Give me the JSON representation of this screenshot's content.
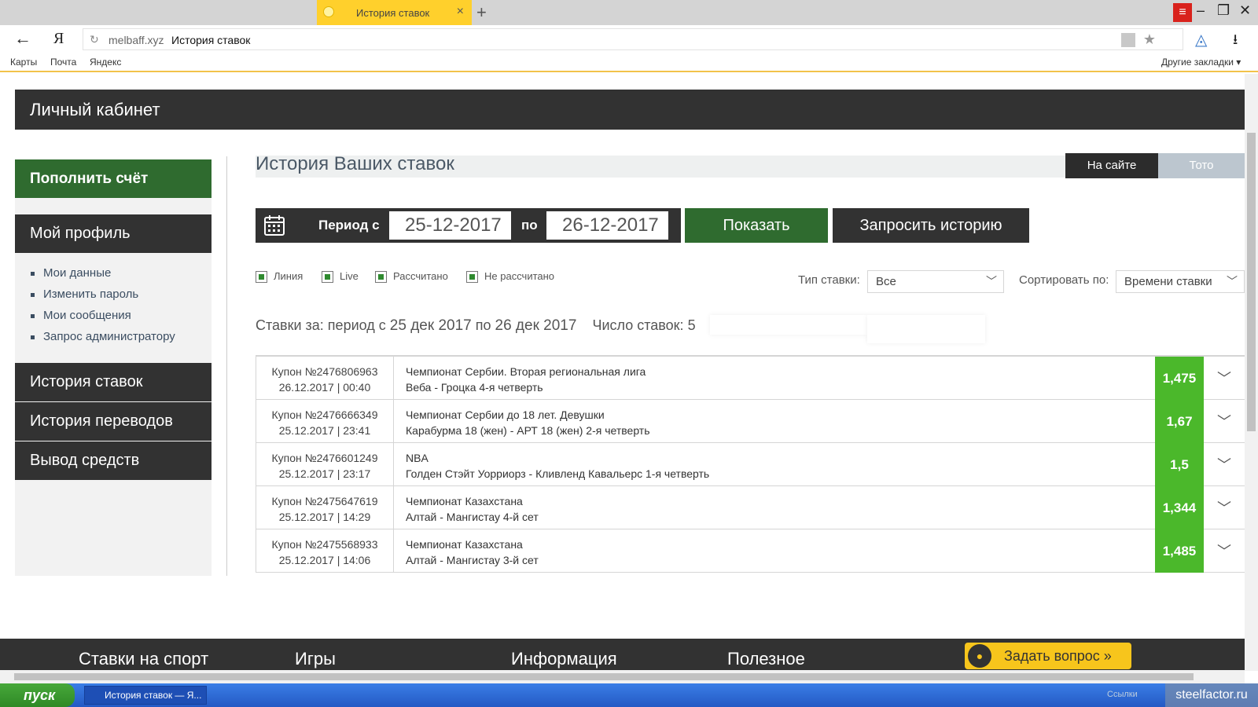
{
  "browser": {
    "tab_title": "История ставок",
    "tab_close": "×",
    "new_tab": "+",
    "url_host": "melbaff.xyz",
    "url_page": "История ставок",
    "bookmarks": [
      "Карты",
      "Почта",
      "Яндекс"
    ],
    "other_bookmarks": "Другие закладки ▾",
    "yandex_logo": "Я"
  },
  "header": {
    "title": "Личный кабинет"
  },
  "sidebar": {
    "deposit": "Пополнить счёт",
    "profile": "Мой профиль",
    "links": [
      "Мои данные",
      "Изменить пароль",
      "Мои сообщения",
      "Запрос администратору"
    ],
    "bet_history": "История ставок",
    "transfer_history": "История переводов",
    "withdraw": "Вывод средств"
  },
  "main": {
    "title": "История Ваших ставок",
    "tabs": [
      "На сайте",
      "Тото"
    ],
    "period_from_label": "Период с",
    "date_from": "25-12-2017",
    "period_to_label": "по",
    "date_to": "26-12-2017",
    "show_button": "Показать",
    "request_button": "Запросить историю",
    "filters": [
      "Линия",
      "Live",
      "Рассчитано",
      "Не рассчитано"
    ],
    "bet_type_label": "Тип ставки:",
    "bet_type_value": "Все",
    "sort_label": "Сортировать по:",
    "sort_value": "Времени ставки",
    "summary_prefix": "Ставки за: период с",
    "summary_from": "25 дек 2017",
    "summary_mid": "по",
    "summary_to": "26 дек 2017",
    "summary_count_label": "Число ставок:",
    "summary_count": "5"
  },
  "bets": [
    {
      "coupon": "Купон №2476806963",
      "datetime": "26.12.2017 | 00:40",
      "league": "Чемпионат Сербии. Вторая региональная лига",
      "match": "Веба - Гроцка 4-я четверть",
      "odds": "1,475"
    },
    {
      "coupon": "Купон №2476666349",
      "datetime": "25.12.2017 | 23:41",
      "league": "Чемпионат Сербии до 18 лет. Девушки",
      "match": "Карабурма 18 (жен) - АРТ 18 (жен) 2-я четверть",
      "odds": "1,67"
    },
    {
      "coupon": "Купон №2476601249",
      "datetime": "25.12.2017 | 23:17",
      "league": "NBA",
      "match": "Голден Стэйт Уорриорз - Кливленд Кавальерс 1-я четверть",
      "odds": "1,5"
    },
    {
      "coupon": "Купон №2475647619",
      "datetime": "25.12.2017 | 14:29",
      "league": "Чемпионат Казахстана",
      "match": "Алтай - Мангистау 4-й сет",
      "odds": "1,344"
    },
    {
      "coupon": "Купон №2475568933",
      "datetime": "25.12.2017 | 14:06",
      "league": "Чемпионат Казахстана",
      "match": "Алтай - Мангистау 3-й сет",
      "odds": "1,485"
    }
  ],
  "footer": {
    "items": [
      "Ставки на спорт",
      "Игры",
      "Информация",
      "Полезное"
    ],
    "ask_button": "Задать вопрос"
  },
  "taskbar": {
    "start": "пуск",
    "task": "История ставок — Я...",
    "tray": "Ссылки",
    "watermark": "steelfactor.ru"
  },
  "colors": {
    "brand_green": "#2f6b2f",
    "odds_green": "#4bb82b",
    "dark": "#323232",
    "accent_yellow": "#f7c51c"
  }
}
